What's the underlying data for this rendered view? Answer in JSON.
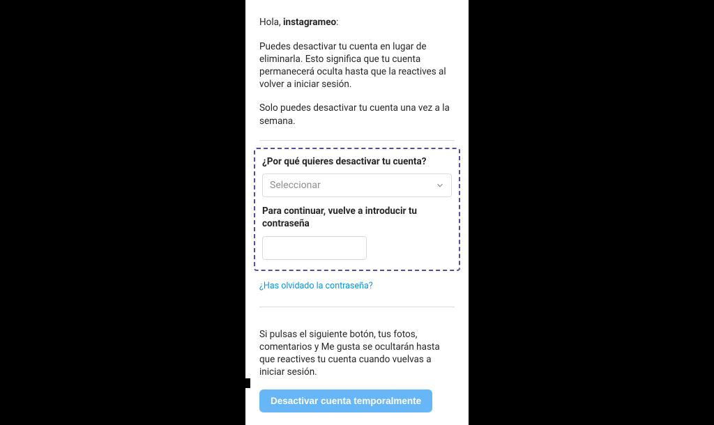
{
  "greeting": {
    "prefix": "Hola, ",
    "name": "instagrameo",
    "suffix": ":"
  },
  "intro_para": "Puedes desactivar tu cuenta en lugar de eliminarla. Esto significa que tu cuenta permanecerá oculta hasta que la reactives al volver a iniciar sesión.",
  "limit_para": "Solo puedes desactivar tu cuenta una vez a la semana.",
  "reason": {
    "label": "¿Por qué quieres desactivar tu cuenta?",
    "placeholder": "Seleccionar"
  },
  "password": {
    "label": "Para continuar, vuelve a introducir tu contraseña"
  },
  "forgot_link": "¿Has olvidado la contraseña?",
  "warn_para": "Si pulsas el siguiente botón, tus fotos, comentarios y Me gusta se ocultarán hasta que reactives tu cuenta cuando vuelvas a iniciar sesión.",
  "button_label": "Desactivar cuenta temporalmente"
}
